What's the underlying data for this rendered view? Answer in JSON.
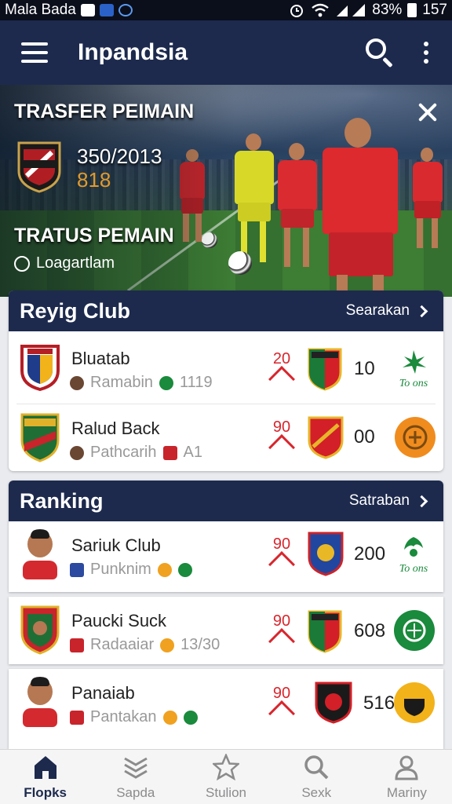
{
  "status_bar": {
    "carrier": "Mala Bada",
    "battery": "83%",
    "time": "157"
  },
  "app_bar": {
    "title": "Inpandsia",
    "icons": [
      "menu-icon",
      "search-icon",
      "more-vert-icon"
    ]
  },
  "hero": {
    "title": "TRASFER PEIMAIN",
    "score": "350/2013",
    "sub_value": "818",
    "title2": "TRATUS PEMAIN",
    "link_label": "Loagartlam",
    "accent_color": "#e19a2e"
  },
  "club_card": {
    "title": "Reyig Club",
    "action_label": "Searakan",
    "rows": [
      {
        "name": "Bluatab",
        "meta": "Ramabin",
        "meta_value": "1119",
        "trend": "20",
        "stat": "10",
        "side_label": "To ons"
      },
      {
        "name": "Ralud Back",
        "meta": "Pathcarih",
        "meta_value": "A1",
        "trend": "90",
        "stat": "00",
        "side_label": ""
      }
    ]
  },
  "ranking_card": {
    "title": "Ranking",
    "action_label": "Satraban",
    "rows": [
      {
        "name": "Sariuk Club",
        "meta": "Punknim",
        "meta_value": "",
        "trend": "90",
        "stat": "200",
        "side_label": "To ons"
      },
      {
        "name": "Paucki Suck",
        "meta": "Radaaiar",
        "meta_value": "13/30",
        "trend": "90",
        "stat": "608",
        "side_label": ""
      },
      {
        "name": "Panaiab",
        "meta": "Pantakan",
        "meta_value": "",
        "trend": "90",
        "stat": "516",
        "side_label": ""
      }
    ]
  },
  "bottom_nav": [
    {
      "label": "Flopks",
      "icon": "home-icon",
      "active": true
    },
    {
      "label": "Sapda",
      "icon": "layers-icon",
      "active": false
    },
    {
      "label": "Stulion",
      "icon": "star-icon",
      "active": false
    },
    {
      "label": "Sexk",
      "icon": "search-icon",
      "active": false
    },
    {
      "label": "Mariny",
      "icon": "profile-icon",
      "active": false
    }
  ],
  "colors": {
    "navy": "#1d2a4d",
    "trend_red": "#d8262d",
    "green": "#1a8a3c"
  }
}
